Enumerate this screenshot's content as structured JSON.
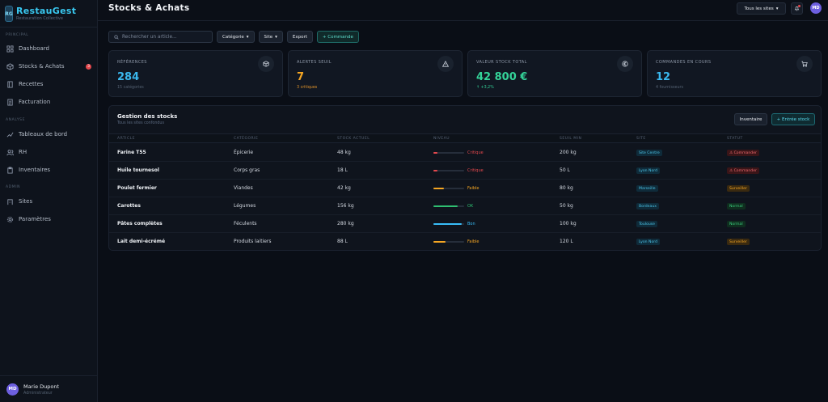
{
  "app": {
    "name": "RestauGest",
    "subtitle": "Restauration Collective"
  },
  "sidebar": {
    "sections": [
      "Principal",
      "Analyse",
      "Admin"
    ],
    "items": [
      {
        "label": "Dashboard",
        "icon": "grid-icon"
      },
      {
        "label": "Stocks & Achats",
        "icon": "box-icon",
        "badge": "3"
      },
      {
        "label": "Recettes",
        "icon": "book-icon"
      },
      {
        "label": "Facturation",
        "icon": "invoice-icon"
      },
      {
        "label": "Tableaux de bord",
        "icon": "chart-icon"
      },
      {
        "label": "RH",
        "icon": "users-icon"
      },
      {
        "label": "Inventaires",
        "icon": "clipboard-icon"
      },
      {
        "label": "Sites",
        "icon": "building-icon"
      },
      {
        "label": "Paramètres",
        "icon": "gear-icon"
      }
    ],
    "user": {
      "name": "Marie Dupont",
      "role": "Administrateur",
      "initials": "MD"
    }
  },
  "header": {
    "title": "Stocks & Achats",
    "site_select": "Tous les sites",
    "avatar_initials": "MD"
  },
  "toolbar": {
    "search_placeholder": "Rechercher un article...",
    "category_filter": "Catégorie",
    "site_filter": "Site",
    "export_label": "Export",
    "new_order_label": "+ Commande"
  },
  "kpis": [
    {
      "label": "Références",
      "value": "284",
      "sub": "15 catégories",
      "icon": "cube-icon",
      "color": "#3ab8ee",
      "sub_color": "#556273"
    },
    {
      "label": "Alertes seuil",
      "value": "7",
      "sub": "3 critiques",
      "icon": "warning-icon",
      "color": "#f5a623",
      "sub_color": "#e0932a"
    },
    {
      "label": "Valeur stock total",
      "value": "42 800 €",
      "sub": "↑ +3,2%",
      "icon": "euro-icon",
      "color": "#34d399",
      "sub_color": "#34d399"
    },
    {
      "label": "Commandes en cours",
      "value": "12",
      "sub": "4 fournisseurs",
      "icon": "cart-icon",
      "color": "#3ab8ee",
      "sub_color": "#556273"
    }
  ],
  "stock_table": {
    "title": "Gestion des stocks",
    "subtitle": "Tous les sites confondus",
    "inventory_btn": "Inventaire",
    "entry_btn": "+ Entrée stock",
    "columns": [
      "Article",
      "Catégorie",
      "Stock actuel",
      "Niveau",
      "Seuil min",
      "Site",
      "Statut"
    ],
    "rows": [
      {
        "article": "Farine T55",
        "category": "Épicerie",
        "stock": "48 kg",
        "level": 0.12,
        "level_label": "Critique",
        "level_color": "#e5484d",
        "min": "200 kg",
        "site": "Site Centre",
        "status": "⚠ Commander",
        "status_kind": "danger"
      },
      {
        "article": "Huile tournesol",
        "category": "Corps gras",
        "stock": "18 L",
        "level": 0.14,
        "level_label": "Critique",
        "level_color": "#e5484d",
        "min": "50 L",
        "site": "Lyon Nord",
        "status": "⚠ Commander",
        "status_kind": "danger"
      },
      {
        "article": "Poulet fermier",
        "category": "Viandes",
        "stock": "42 kg",
        "level": 0.35,
        "level_label": "Faible",
        "level_color": "#f5a623",
        "min": "80 kg",
        "site": "Marseille",
        "status": "Surveiller",
        "status_kind": "warn"
      },
      {
        "article": "Carottes",
        "category": "Légumes",
        "stock": "156 kg",
        "level": 0.78,
        "level_label": "OK",
        "level_color": "#2fbf71",
        "min": "50 kg",
        "site": "Bordeaux",
        "status": "Normal",
        "status_kind": "ok"
      },
      {
        "article": "Pâtes complètes",
        "category": "Féculents",
        "stock": "280 kg",
        "level": 0.92,
        "level_label": "Bon",
        "level_color": "#38bdf8",
        "min": "100 kg",
        "site": "Toulouse",
        "status": "Normal",
        "status_kind": "ok"
      },
      {
        "article": "Lait demi-écrémé",
        "category": "Produits laitiers",
        "stock": "88 L",
        "level": 0.4,
        "level_label": "Faible",
        "level_color": "#f5a623",
        "min": "120 L",
        "site": "Lyon Nord",
        "status": "Surveiller",
        "status_kind": "warn"
      }
    ]
  }
}
